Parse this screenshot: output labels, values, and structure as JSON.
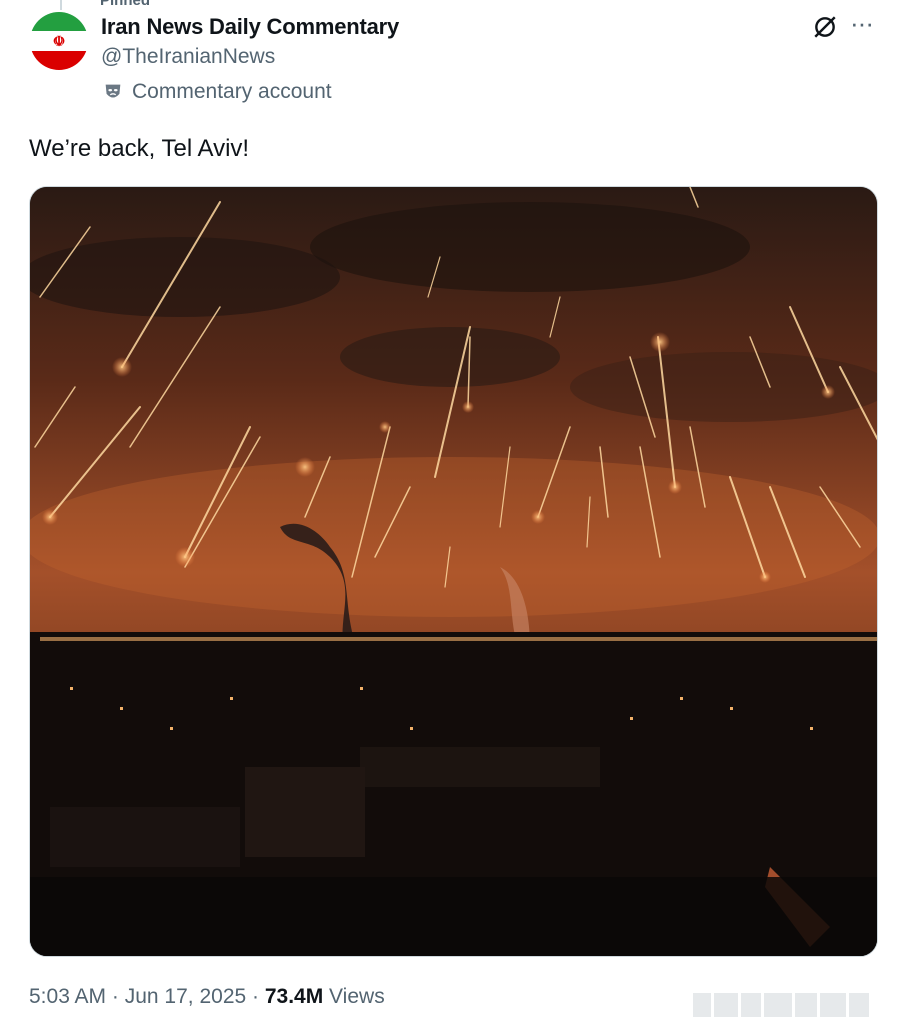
{
  "pinned_label": "Pinned",
  "account": {
    "display_name": "Iran News Daily Commentary",
    "handle": "@TheIranianNews",
    "badge_label": "Commentary account",
    "avatar_icon": "iran-flag-icon"
  },
  "icons": {
    "grok": "grok-icon",
    "more": "more-icon",
    "badge": "mask-icon"
  },
  "post": {
    "text": "We’re back, Tel Aviv!",
    "media_description_icon": "photo"
  },
  "footer": {
    "time": "5:03 AM",
    "separator1": " · ",
    "date": "Jun 17, 2025",
    "separator2": " · ",
    "views_count": "73.4M",
    "views_label": " Views"
  },
  "colors": {
    "text": "#0f1419",
    "secondary": "#536471",
    "flag_green": "#239f40",
    "flag_red": "#da0000"
  }
}
